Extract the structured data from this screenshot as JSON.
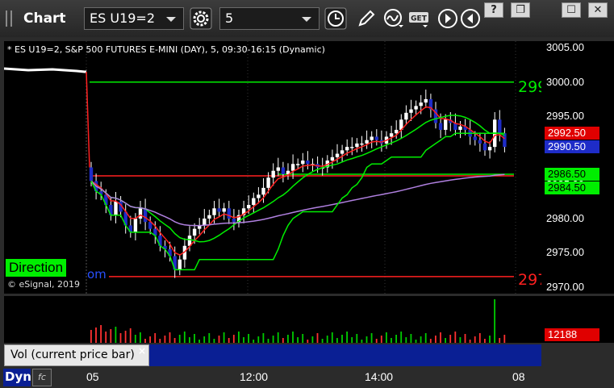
{
  "toolbar": {
    "title": "Chart",
    "symbol": "ES U19=2",
    "interval": "5",
    "buttons": [
      {
        "name": "settings-gear-icon"
      },
      {
        "name": "time-clock-icon"
      },
      {
        "name": "draw-pencil-icon"
      },
      {
        "name": "studies-wave-icon"
      },
      {
        "name": "get-data-icon",
        "label": "GET"
      },
      {
        "name": "forward-play-icon"
      },
      {
        "name": "back-rewind-icon"
      }
    ],
    "window": {
      "help": "?",
      "restore": "❐",
      "maximize": "☐",
      "close": "✕"
    }
  },
  "chart": {
    "header": "* ES U19=2, S&P 500 FUTURES E-MINI (DAY), 5, 09:30-16:15 (Dynamic)",
    "direction_label": "Direction",
    "partial_text": "om",
    "copyright": "© eSignal, 2019",
    "level_top_label": "299",
    "level_bottom_label": "297",
    "price_ticks": [
      "3005.00",
      "3000.00",
      "2995.00",
      "2990.00",
      "2985.00",
      "2980.00",
      "2975.00",
      "2970.00"
    ],
    "badges": [
      {
        "value": "2992.50",
        "bg": "#e00000",
        "fg": "#ffffff"
      },
      {
        "value": "2990.50",
        "bg": "#1e2cc8",
        "fg": "#ffffff"
      },
      {
        "value": "2986.50",
        "bg": "#00ee00",
        "fg": "#000000"
      },
      {
        "value": "2984.50",
        "bg": "#00ee00",
        "fg": "#000000"
      }
    ],
    "colors": {
      "level_top": "#00ee00",
      "level_bottom": "#ff2020",
      "ma_red": "#ff2020",
      "ma_green": "#00ee00",
      "ma_purple": "#b080e0",
      "up": "#ffffff",
      "down": "#1e2cc8"
    }
  },
  "chart_data": {
    "type": "candlestick",
    "title": "* ES U19=2, S&P 500 FUTURES E-MINI (DAY), 5, 09:30-16:15 (Dynamic)",
    "ylim": [
      2969,
      3006
    ],
    "levels": [
      3000.0,
      2986.5,
      2971.5
    ],
    "closes": [
      2985.5,
      2984.0,
      2983.5,
      2982.0,
      2980.5,
      2982.5,
      2981.0,
      2979.0,
      2978.0,
      2980.0,
      2981.5,
      2979.5,
      2978.5,
      2977.5,
      2976.0,
      2975.5,
      2974.5,
      2972.5,
      2974.0,
      2976.0,
      2977.5,
      2978.5,
      2979.0,
      2980.0,
      2980.5,
      2981.5,
      2981.0,
      2981.5,
      2980.0,
      2979.5,
      2980.5,
      2981.5,
      2982.0,
      2983.0,
      2983.5,
      2984.5,
      2986.0,
      2987.0,
      2987.5,
      2986.5,
      2987.0,
      2988.0,
      2988.0,
      2988.5,
      2988.0,
      2988.0,
      2987.5,
      2987.5,
      2988.5,
      2989.0,
      2989.5,
      2990.0,
      2990.5,
      2990.5,
      2991.0,
      2991.0,
      2991.5,
      2992.0,
      2991.5,
      2991.0,
      2992.0,
      2992.5,
      2993.0,
      2994.5,
      2995.5,
      2996.0,
      2996.5,
      2997.0,
      2997.5,
      2996.0,
      2994.0,
      2993.0,
      2994.5,
      2994.0,
      2993.0,
      2993.5,
      2993.0,
      2992.0,
      2991.5,
      2991.0,
      2990.0,
      2990.5,
      2994.5,
      2992.5,
      2990.5
    ],
    "volume_last": "12188",
    "x_ticks": [
      "05",
      "12:00",
      "14:00",
      "08"
    ],
    "series": [
      {
        "name": "ma_red",
        "color": "#ff2020"
      },
      {
        "name": "ma_green",
        "color": "#00ee00"
      },
      {
        "name": "ma_purple",
        "color": "#b080e0"
      },
      {
        "name": "step_green",
        "color": "#00ee00"
      }
    ]
  },
  "volume": {
    "label": "Vol (current price bar)",
    "close": "×"
  },
  "bottom": {
    "dyn": "Dyn",
    "fc": "fc"
  }
}
